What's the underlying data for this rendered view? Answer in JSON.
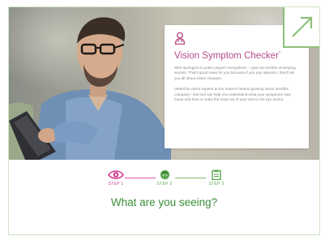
{
  "hero": {
    "card": {
      "icon": "doctor-icon",
      "title": "Vision Symptom Checker",
      "title_mark": "*",
      "paragraph_1": "With apologies to poker players everywhere – eyes are terrible at keeping secrets. That's good news for you because if you pay attention, they'll tell you all about vision changes.",
      "paragraph_2": "Vetted by vision experts at the nation's fastest growing vision benefits company*, this tool can help you understand what your symptoms may mean and how to make the most out of your visit to the eye doctor."
    },
    "corner_icon": "arrow-expand-icon"
  },
  "stepper": {
    "steps": [
      {
        "label": "STEP 1",
        "icon": "eye-icon",
        "active": true
      },
      {
        "label": "STEP 2",
        "icon": "face-icon",
        "active": false
      },
      {
        "label": "STEP 3",
        "icon": "clipboard-icon",
        "active": false
      }
    ],
    "question": "What are you seeing?"
  },
  "colors": {
    "accent_pink": "#cf3f93",
    "accent_green": "#59a84f",
    "frame_green": "#8cc079"
  }
}
